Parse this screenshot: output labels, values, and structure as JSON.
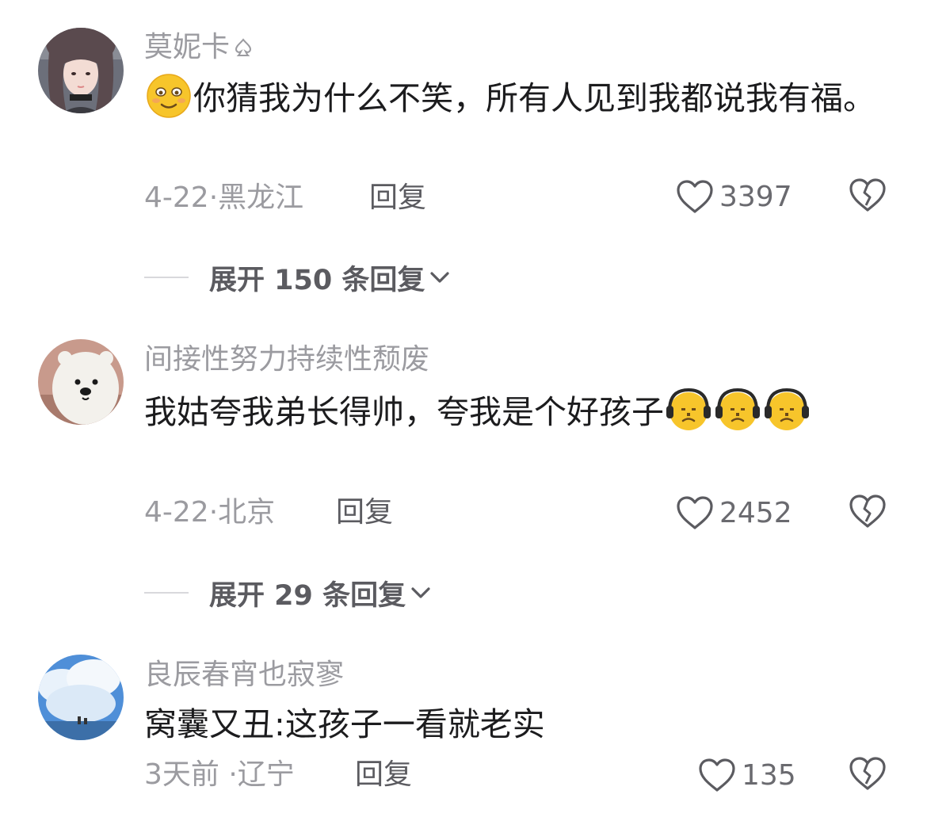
{
  "comments": [
    {
      "username": "莫妮卡",
      "badge_icon": "spade-outline-icon",
      "text_before": "",
      "text_main": "你猜我为什么不笑，所有人见到我都说我有福。",
      "emoji_leading": "smirk-face-emoji",
      "date": "4-22",
      "location": "黑龙江",
      "reply_label": "回复",
      "likes": "3397",
      "expand_label": "展开 150 条回复"
    },
    {
      "username": "间接性努力持续性颓废",
      "text_main": "我姑夸我弟长得帅，夸我是个好孩子",
      "emoji_trailing": "headphone-face-emoji",
      "emoji_trailing_count": 3,
      "date": "4-22",
      "location": "北京",
      "reply_label": "回复",
      "likes": "2452",
      "expand_label": "展开 29 条回复"
    },
    {
      "username": "良辰春宵也寂寥",
      "text_main": "窝囊又丑:这孩子一看就老实",
      "date": "3天前",
      "location": "辽宁",
      "reply_label": "回复",
      "likes": "135"
    }
  ],
  "colors": {
    "meta_gray": "#9b9ba0",
    "text_dark": "#1c1c1e",
    "emoji_yellow": "#f7c52b"
  }
}
